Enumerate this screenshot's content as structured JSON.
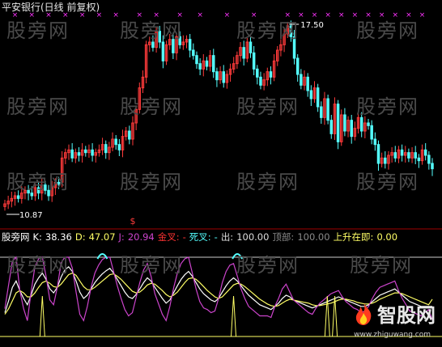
{
  "title": "平安银行(日线 前复权)",
  "watermark": "股旁网",
  "colors": {
    "up": "#ff3b3b",
    "down": "#54ffff",
    "k": "#ffffff",
    "d": "#ffff66",
    "j": "#cc44cc",
    "marker": "#ff33ff",
    "gold": "#ff3333",
    "dead": "#54ffff",
    "exit": "#dddddd",
    "top": "#8a8a8a",
    "rise": "#ffff66",
    "flat_line": "#cccccc"
  },
  "indicator": {
    "name": "股旁网",
    "k_label": "K:",
    "k_value": "38.36",
    "d_label": "D:",
    "d_value": "47.07",
    "j_label": "J:",
    "j_value": "20.94",
    "gold_label": "金叉:",
    "gold_value": "-",
    "dead_label": "死叉:",
    "dead_value": "-",
    "exit_label": "出:",
    "exit_value": "100.00",
    "top_label": "顶部:",
    "top_value": "100.00",
    "rise_label": "上升在即:",
    "rise_value": "0.00"
  },
  "logo": {
    "text": "智股网",
    "url": "www.zhiguwang.com"
  },
  "chart_data": [
    {
      "type": "candlestick",
      "title": "平安银行(日线 前复权)",
      "annotations": [
        {
          "text": "17.50",
          "type": "high"
        },
        {
          "text": "10.87",
          "type": "low"
        }
      ],
      "signal_marker": "$",
      "close": [
        10.9,
        11.0,
        11.1,
        11.2,
        11.1,
        11.3,
        11.4,
        11.3,
        11.2,
        11.5,
        11.3,
        11.6,
        11.4,
        11.2,
        11.5,
        11.7,
        11.6,
        12.6,
        12.8,
        12.9,
        12.6,
        12.8,
        12.7,
        12.9,
        12.8,
        12.9,
        12.7,
        12.8,
        12.9,
        13.1,
        12.8,
        13.0,
        13.3,
        13.1,
        12.9,
        13.4,
        13.6,
        13.3,
        13.9,
        14.4,
        15.2,
        15.6,
        16.8,
        16.9,
        16.7,
        17.3,
        16.9,
        16.2,
        16.8,
        17.0,
        16.5,
        17.1,
        16.8,
        16.9,
        17.0,
        16.6,
        16.4,
        16.1,
        15.9,
        16.2,
        16.0,
        16.4,
        15.8,
        15.5,
        15.8,
        15.4,
        15.7,
        15.9,
        16.1,
        16.4,
        16.7,
        16.3,
        16.9,
        16.5,
        15.9,
        15.6,
        15.3,
        15.5,
        15.8,
        15.6,
        16.2,
        16.6,
        16.8,
        17.2,
        17.5,
        17.1,
        16.3,
        15.7,
        15.3,
        15.6,
        15.1,
        14.8,
        15.2,
        14.5,
        14.1,
        14.8,
        14.0,
        13.5,
        14.6,
        13.2,
        14.2,
        13.6,
        14.0,
        13.4,
        13.7,
        14.1,
        13.6,
        13.9,
        13.8,
        13.3,
        13.1,
        12.4,
        12.6,
        12.4,
        12.7,
        12.8,
        12.6,
        12.9,
        12.7,
        12.8,
        12.6,
        12.8,
        12.6,
        12.5,
        12.9,
        12.7,
        12.4,
        12.2
      ],
      "open": [
        10.8,
        10.9,
        11.0,
        11.1,
        11.2,
        11.1,
        11.3,
        11.4,
        11.3,
        11.2,
        11.5,
        11.3,
        11.6,
        11.4,
        11.2,
        11.5,
        11.7,
        11.7,
        12.6,
        12.8,
        12.9,
        12.6,
        12.8,
        12.7,
        12.9,
        12.8,
        12.9,
        12.7,
        12.8,
        12.9,
        13.1,
        12.8,
        13.0,
        13.3,
        13.1,
        12.9,
        13.4,
        13.6,
        13.3,
        13.9,
        14.4,
        15.2,
        15.6,
        16.8,
        16.9,
        16.7,
        17.3,
        16.9,
        16.2,
        16.8,
        17.0,
        16.5,
        17.1,
        16.8,
        16.9,
        17.0,
        16.6,
        16.4,
        16.1,
        15.9,
        16.2,
        16.0,
        16.4,
        15.8,
        15.5,
        15.8,
        15.4,
        15.7,
        15.9,
        16.1,
        16.4,
        16.7,
        16.3,
        16.9,
        16.5,
        15.9,
        15.6,
        15.3,
        15.5,
        15.8,
        15.6,
        16.2,
        16.6,
        16.8,
        17.2,
        17.5,
        17.1,
        16.3,
        15.7,
        15.3,
        15.6,
        15.1,
        14.8,
        15.2,
        14.5,
        14.1,
        14.8,
        14.0,
        13.5,
        14.6,
        13.2,
        14.2,
        13.6,
        14.0,
        13.4,
        13.7,
        14.1,
        13.6,
        13.9,
        13.8,
        13.3,
        13.1,
        12.4,
        12.6,
        12.4,
        12.7,
        12.8,
        12.6,
        12.9,
        12.7,
        12.8,
        12.6,
        12.8,
        12.6,
        12.5,
        12.9,
        12.7,
        12.4
      ]
    },
    {
      "type": "line",
      "ylim": [
        0,
        100
      ],
      "series": [
        {
          "name": "K",
          "values": [
            30,
            45,
            62,
            70,
            58,
            48,
            40,
            52,
            66,
            74,
            80,
            72,
            60,
            55,
            62,
            75,
            84,
            88,
            82,
            70,
            56,
            48,
            52,
            60,
            68,
            74,
            79,
            83,
            86,
            80,
            72,
            64,
            56,
            50,
            48,
            53,
            60,
            68,
            74,
            70,
            62,
            55,
            48,
            42,
            46,
            55,
            64,
            72,
            78,
            82,
            76,
            68,
            60,
            54,
            50,
            46,
            44,
            48,
            56,
            64,
            70,
            74,
            70,
            64,
            58,
            52,
            48,
            44,
            40,
            38,
            36,
            34,
            38,
            42,
            48,
            52,
            50,
            46,
            44,
            42,
            40,
            38,
            36,
            38,
            40,
            42,
            44,
            46,
            48,
            50,
            48,
            46,
            44,
            42,
            40,
            38,
            38,
            40,
            44,
            48,
            52,
            54,
            56,
            58,
            60,
            56,
            52,
            48,
            44,
            42,
            40,
            38,
            38,
            38,
            38
          ]
        },
        {
          "name": "D",
          "values": [
            28,
            35,
            45,
            55,
            58,
            55,
            50,
            50,
            55,
            62,
            68,
            70,
            67,
            63,
            62,
            66,
            72,
            78,
            80,
            77,
            70,
            63,
            59,
            59,
            62,
            66,
            70,
            74,
            78,
            79,
            76,
            72,
            67,
            62,
            57,
            55,
            56,
            60,
            65,
            67,
            66,
            62,
            58,
            53,
            50,
            52,
            56,
            62,
            68,
            73,
            74,
            72,
            68,
            63,
            58,
            54,
            50,
            48,
            50,
            55,
            60,
            65,
            67,
            66,
            63,
            59,
            55,
            51,
            47,
            44,
            41,
            39,
            38,
            39,
            42,
            45,
            47,
            46,
            45,
            44,
            43,
            42,
            40,
            39,
            39,
            40,
            41,
            42,
            44,
            46,
            47,
            47,
            46,
            45,
            43,
            42,
            41,
            41,
            42,
            44,
            47,
            49,
            51,
            53,
            55,
            55,
            54,
            52,
            50,
            48,
            46,
            44,
            42,
            40,
            47
          ]
        },
        {
          "name": "J",
          "values": [
            35,
            65,
            95,
            100,
            58,
            35,
            20,
            56,
            88,
            98,
            100,
            76,
            46,
            40,
            62,
            93,
            100,
            100,
            86,
            56,
            28,
            20,
            38,
            62,
            80,
            90,
            97,
            100,
            100,
            82,
            64,
            48,
            34,
            26,
            30,
            49,
            68,
            84,
            92,
            76,
            54,
            41,
            28,
            20,
            38,
            61,
            80,
            92,
            98,
            100,
            80,
            60,
            44,
            36,
            34,
            30,
            32,
            48,
            68,
            82,
            90,
            92,
            76,
            60,
            48,
            38,
            34,
            30,
            26,
            26,
            26,
            24,
            38,
            48,
            60,
            66,
            56,
            46,
            42,
            38,
            34,
            30,
            28,
            36,
            42,
            46,
            50,
            54,
            56,
            58,
            50,
            44,
            40,
            36,
            34,
            30,
            32,
            38,
            48,
            56,
            62,
            64,
            66,
            68,
            70,
            58,
            48,
            40,
            32,
            30,
            28,
            26,
            30,
            34,
            21
          ]
        }
      ]
    }
  ]
}
